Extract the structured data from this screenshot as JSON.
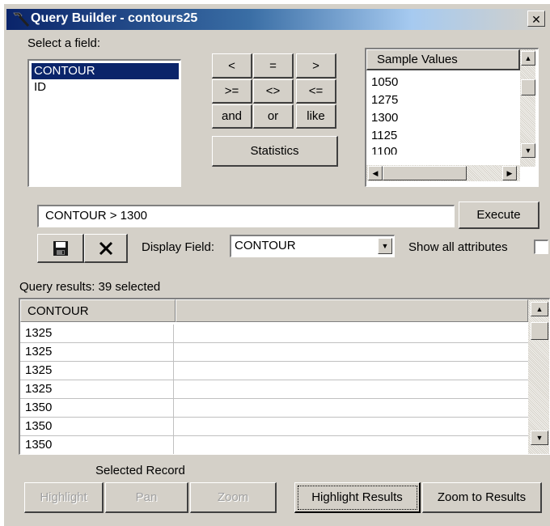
{
  "window": {
    "title": "Query Builder - contours25",
    "close_label": "✕"
  },
  "fields": {
    "label": "Select a field:",
    "items": [
      {
        "label": "CONTOUR",
        "selected": true
      },
      {
        "label": "ID",
        "selected": false
      }
    ]
  },
  "operators": {
    "lt": "<",
    "eq": "=",
    "gt": ">",
    "gte": ">=",
    "ne": "<>",
    "lte": "<=",
    "and": "and",
    "or": "or",
    "like": "like",
    "statistics": "Statistics"
  },
  "sample_values": {
    "header": "Sample Values",
    "items": [
      "1050",
      "1275",
      "1300",
      "1125",
      "1100"
    ]
  },
  "query": {
    "expression": "CONTOUR > 1300",
    "execute_label": "Execute"
  },
  "toolbar": {
    "save_icon": "floppy-disk-icon",
    "clear_icon": "x-icon",
    "display_field_label": "Display Field:",
    "display_field_value": "CONTOUR",
    "show_all_label": "Show all attributes",
    "show_all_checked": false
  },
  "results": {
    "summary": "Query results: 39 selected",
    "column_header": "CONTOUR",
    "rows": [
      "1325",
      "1325",
      "1325",
      "1325",
      "1350",
      "1350",
      "1350"
    ]
  },
  "footer": {
    "selected_record_label": "Selected Record",
    "highlight_label": "Highlight",
    "pan_label": "Pan",
    "zoom_label": "Zoom",
    "highlight_results_label": "Highlight Results",
    "zoom_results_label": "Zoom to Results"
  },
  "colors": {
    "title_bar": "#0a246a",
    "selection": "#0a246a",
    "face": "#d4d0c8"
  }
}
